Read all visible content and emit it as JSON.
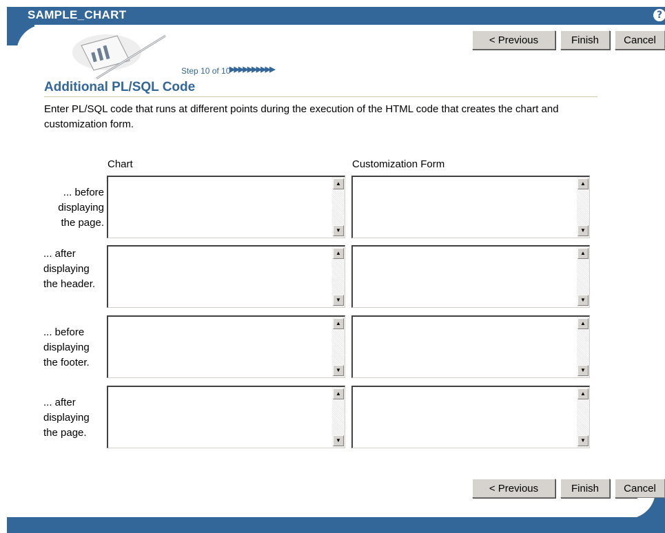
{
  "app": {
    "title": "SAMPLE_CHART",
    "help_icon": "?"
  },
  "nav": {
    "previous_label": "< Previous",
    "finish_label": "Finish",
    "cancel_label": "Cancel"
  },
  "step": {
    "text": "Step 10 of 10",
    "arrows": "▶▶▶▶▶▶▶▶▶▶"
  },
  "page": {
    "heading": "Additional PL/SQL Code",
    "description": "Enter PL/SQL code that runs at different points during the execution of the HTML code that creates the chart and customization form."
  },
  "columns": {
    "chart": "Chart",
    "customization": "Customization Form"
  },
  "rows": [
    {
      "label": "... before displaying the page.",
      "chart_value": "",
      "form_value": ""
    },
    {
      "label": "... after displaying the header.",
      "chart_value": "",
      "form_value": ""
    },
    {
      "label": "... before displaying the footer.",
      "chart_value": "",
      "form_value": ""
    },
    {
      "label": "... after displaying the page.",
      "chart_value": "",
      "form_value": ""
    }
  ],
  "colors": {
    "brand": "#336699",
    "button": "#d6d3ce"
  }
}
